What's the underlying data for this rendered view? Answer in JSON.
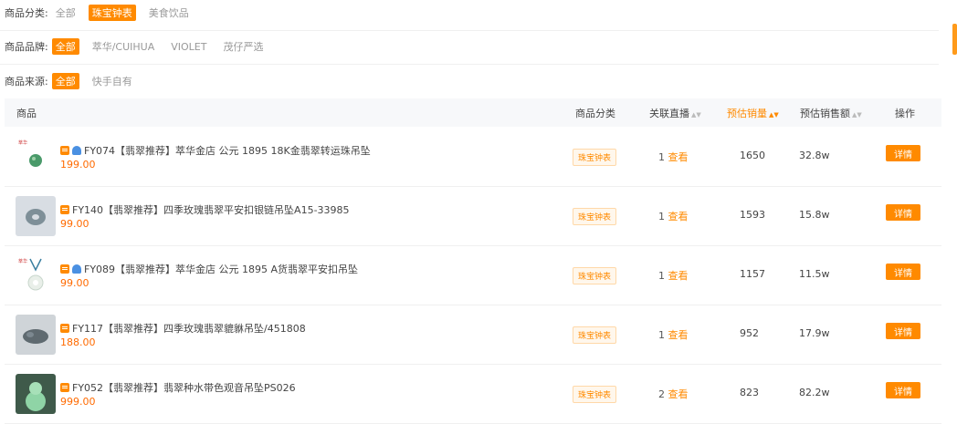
{
  "filters": {
    "category": {
      "label": "商品分类:",
      "options": [
        "全部",
        "珠宝钟表",
        "美食饮品"
      ],
      "active": 1
    },
    "brand": {
      "label": "商品品牌:",
      "options": [
        "全部",
        "萃华/CUIHUA",
        "VIOLET",
        "茂仔严选"
      ],
      "active": 0
    },
    "source": {
      "label": "商品来源:",
      "options": [
        "全部",
        "快手自有"
      ],
      "active": 0
    }
  },
  "table": {
    "headers": {
      "product": "商品",
      "category": "商品分类",
      "live": "关联直播",
      "sales": "预估销量",
      "amount": "预估销售额",
      "action": "操作"
    },
    "rows": [
      {
        "title": "FY074【翡翠推荐】萃华金店 公元 1895 18K金翡翠转运珠吊坠",
        "price": "199.00",
        "category": "珠宝钟表",
        "live_count": "1",
        "live_link": "查看",
        "sales": "1650",
        "amount": "32.8w",
        "action": "详情",
        "has_anchor": true,
        "thumb": "bead"
      },
      {
        "title": "FY140【翡翠推荐】四季玫瑰翡翠平安扣银链吊坠A15-33985",
        "price": "99.00",
        "category": "珠宝钟表",
        "live_count": "1",
        "live_link": "查看",
        "sales": "1593",
        "amount": "15.8w",
        "action": "详情",
        "has_anchor": false,
        "thumb": "disc"
      },
      {
        "title": "FY089【翡翠推荐】萃华金店 公元 1895 A货翡翠平安扣吊坠",
        "price": "99.00",
        "category": "珠宝钟表",
        "live_count": "1",
        "live_link": "查看",
        "sales": "1157",
        "amount": "11.5w",
        "action": "详情",
        "has_anchor": true,
        "thumb": "pendant"
      },
      {
        "title": "FY117【翡翠推荐】四季玫瑰翡翠貔貅吊坠/451808",
        "price": "188.00",
        "category": "珠宝钟表",
        "live_count": "1",
        "live_link": "查看",
        "sales": "952",
        "amount": "17.9w",
        "action": "详情",
        "has_anchor": false,
        "thumb": "beast"
      },
      {
        "title": "FY052【翡翠推荐】翡翠种水带色观音吊坠PS026",
        "price": "999.00",
        "category": "珠宝钟表",
        "live_count": "2",
        "live_link": "查看",
        "sales": "823",
        "amount": "82.2w",
        "action": "详情",
        "has_anchor": false,
        "thumb": "buddha"
      }
    ]
  },
  "colors": {
    "accent": "#ff8a00",
    "price": "#ff6a00"
  }
}
